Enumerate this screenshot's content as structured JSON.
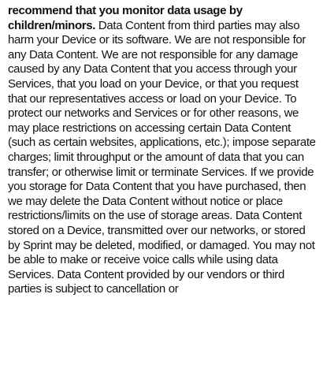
{
  "document": {
    "bold_lead": "recommend that you monitor data usage by children/minors.",
    "body": " Data Content from third parties may also harm your Device or its software. We are not responsible for any Data Content. We are not responsible for any damage caused by any Data Content that you access through your Services, that you load on your Device, or that you request that our representatives access or load on your Device. To protect our networks and Services or for other reasons, we may place restrictions on accessing certain Data Content (such as certain websites, applications, etc.); impose separate charges; limit throughput or the amount of data that you can transfer; or otherwise limit or terminate Services. If we provide you storage for Data Content that you have purchased, then we may delete the Data Content without notice or place restrictions/limits on the use of storage areas. Data Content stored on a Device, transmitted over our networks, or stored by Sprint may be deleted, modified, or damaged. You may not be able to make or receive voice calls while using data Services. Data Content provided by our vendors or third parties is subject to cancellation or"
  }
}
